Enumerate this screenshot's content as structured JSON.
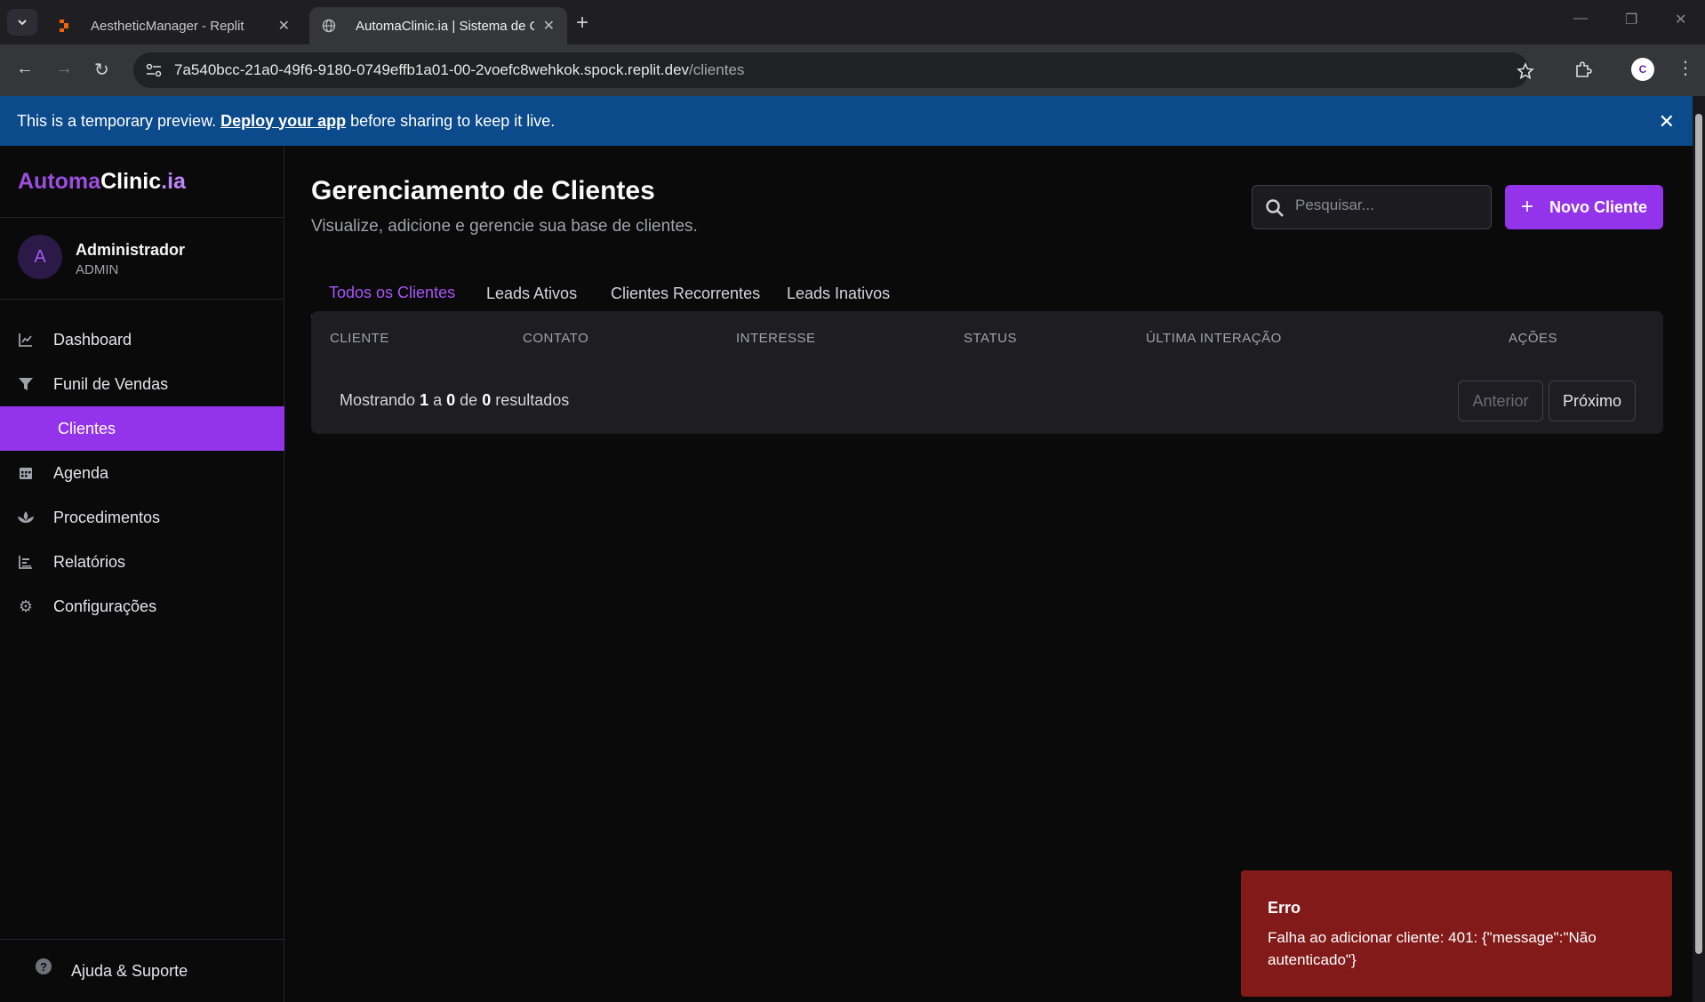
{
  "browser": {
    "tabs": [
      {
        "title": "AestheticManager - Replit",
        "active": false
      },
      {
        "title": "AutomaClinic.ia | Sistema de CRM",
        "active": true
      }
    ],
    "url_host": "7a540bcc-21a0-49f6-9180-0749effb1a01-00-2voefc8wehkok.spock.replit.dev",
    "url_path": "/clientes"
  },
  "banner": {
    "prefix": "This is a temporary preview.",
    "link": "Deploy your app",
    "suffix": "before sharing to keep it live."
  },
  "sidebar": {
    "logo": {
      "part1": "Automa",
      "part2": "Clinic",
      "part3": ".ia"
    },
    "user": {
      "initial": "A",
      "name": "Administrador",
      "role": "ADMIN"
    },
    "items": [
      {
        "label": "Dashboard",
        "icon": "chart-line-icon"
      },
      {
        "label": "Funil de Vendas",
        "icon": "filter-icon"
      },
      {
        "label": "Clientes",
        "icon": "users-icon",
        "active": true
      },
      {
        "label": "Agenda",
        "icon": "calendar-icon"
      },
      {
        "label": "Procedimentos",
        "icon": "spa-icon"
      },
      {
        "label": "Relatórios",
        "icon": "chart-bar-icon"
      },
      {
        "label": "Configurações",
        "icon": "gear-icon"
      }
    ],
    "help": "Ajuda & Suporte"
  },
  "main": {
    "title": "Gerenciamento de Clientes",
    "subtitle": "Visualize, adicione e gerencie sua base de clientes.",
    "search_placeholder": "Pesquisar...",
    "new_button": "Novo Cliente",
    "tabs": [
      "Todos os Clientes",
      "Leads Ativos",
      "Clientes Recorrentes",
      "Leads Inativos"
    ],
    "columns": [
      "CLIENTE",
      "CONTATO",
      "INTERESSE",
      "STATUS",
      "ÚLTIMA INTERAÇÃO",
      "AÇÕES"
    ],
    "pager": {
      "prefix": "Mostrando",
      "from": "1",
      "a": "a",
      "to": "0",
      "de": "de",
      "total": "0",
      "suffix": "resultados"
    },
    "prev": "Anterior",
    "next": "Próximo"
  },
  "toast": {
    "title": "Erro",
    "message": "Falha ao adicionar cliente: 401: {\"message\":\"Não autenticado\"}"
  },
  "colors": {
    "accent": "#9333ea",
    "error": "#831a1a",
    "banner": "#0b4a8b"
  }
}
